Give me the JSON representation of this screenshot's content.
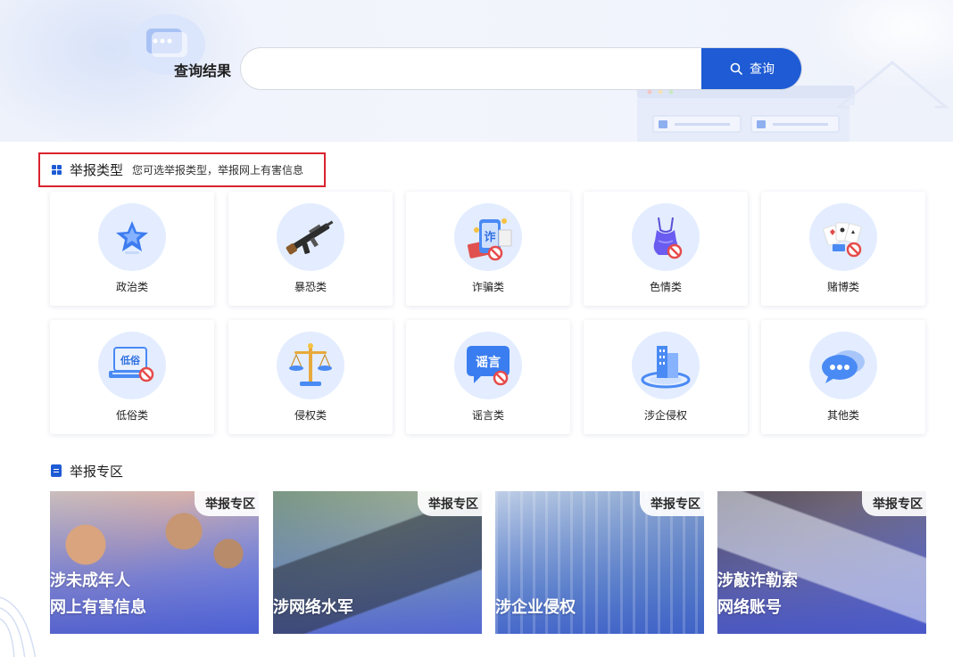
{
  "search": {
    "label": "查询结果",
    "placeholder": "",
    "value": "",
    "button_label": "查询"
  },
  "report_types": {
    "title": "举报类型",
    "subtitle": "您可选举报类型，举报网上有害信息",
    "items": [
      {
        "label": "政治类",
        "icon": "star-icon"
      },
      {
        "label": "暴恐类",
        "icon": "rifle-icon"
      },
      {
        "label": "诈骗类",
        "icon": "fraud-phone-icon"
      },
      {
        "label": "色情类",
        "icon": "lingerie-icon"
      },
      {
        "label": "赌博类",
        "icon": "gambling-cards-icon"
      },
      {
        "label": "低俗类",
        "icon": "vulgar-laptop-icon"
      },
      {
        "label": "侵权类",
        "icon": "scales-icon"
      },
      {
        "label": "谣言类",
        "icon": "rumor-bubble-icon"
      },
      {
        "label": "涉企侵权",
        "icon": "enterprise-building-icon"
      },
      {
        "label": "其他类",
        "icon": "chat-bubbles-icon"
      }
    ]
  },
  "zones": {
    "title": "举报专区",
    "items": [
      {
        "tag": "举报专区",
        "line1": "涉未成年人",
        "line2": "网上有害信息"
      },
      {
        "tag": "举报专区",
        "line1": "",
        "line2": "涉网络水军"
      },
      {
        "tag": "举报专区",
        "line1": "",
        "line2": "涉企业侵权"
      },
      {
        "tag": "举报专区",
        "line1": "涉敲诈勒索",
        "line2": "网络账号"
      }
    ]
  },
  "colors": {
    "accent": "#1e5bd4",
    "highlight_border": "#d9232e",
    "icon_bg": "#e3edff"
  }
}
